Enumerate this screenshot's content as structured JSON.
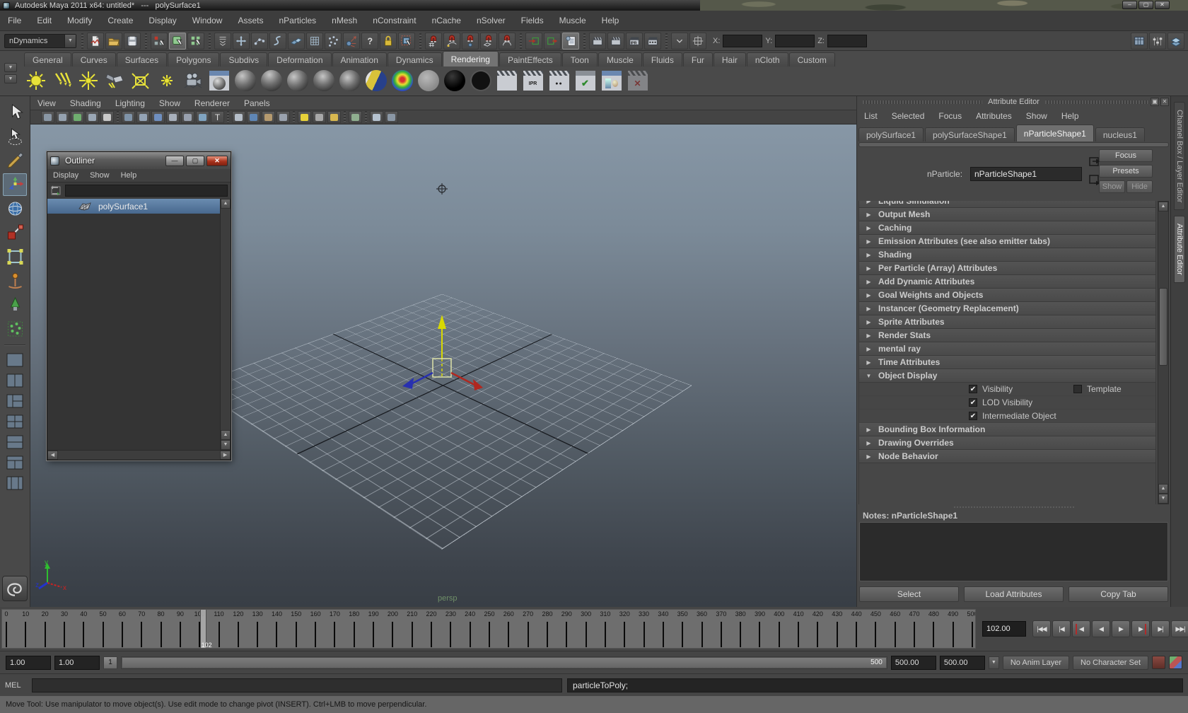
{
  "window": {
    "title": "Autodesk Maya 2011 x64: untitled*   ---   polySurface1",
    "controls": [
      {
        "name": "minimize-button",
        "glyph": "–"
      },
      {
        "name": "maximize-button",
        "glyph": "▢"
      },
      {
        "name": "close-button",
        "glyph": "✕"
      }
    ]
  },
  "menubar": {
    "items": [
      "File",
      "Edit",
      "Modify",
      "Create",
      "Display",
      "Window",
      "Assets",
      "nParticles",
      "nMesh",
      "nConstraint",
      "nCache",
      "nSolver",
      "Fields",
      "Muscle",
      "Help"
    ]
  },
  "statusline": {
    "menuset": "nDynamics",
    "coords": {
      "x_label": "X:",
      "y_label": "Y:",
      "z_label": "Z:",
      "x_value": "",
      "y_value": "",
      "z_value": ""
    },
    "icon_items": [
      {
        "sep": true
      },
      {
        "name": "new-scene-icon",
        "kind": "filenew"
      },
      {
        "name": "open-scene-icon",
        "kind": "fileopen"
      },
      {
        "name": "save-scene-icon",
        "kind": "filesave"
      },
      {
        "sep": true
      },
      {
        "name": "select-by-hierarchy-icon",
        "kind": "selhier"
      },
      {
        "name": "select-by-object-icon",
        "kind": "selobj",
        "active": true
      },
      {
        "name": "select-by-component-icon",
        "kind": "selcomp"
      },
      {
        "sep": true
      },
      {
        "name": "snap-toggle-chevron-icon",
        "kind": "chev"
      },
      {
        "name": "mask-handles-icon",
        "kind": "pluscross"
      },
      {
        "name": "mask-points-icon",
        "kind": "dotscurve"
      },
      {
        "name": "mask-curves-icon",
        "kind": "scurve"
      },
      {
        "name": "mask-surfaces-icon",
        "kind": "planes"
      },
      {
        "name": "mask-deformations-icon",
        "kind": "lattice"
      },
      {
        "name": "mask-dynamics-icon",
        "kind": "stardots"
      },
      {
        "name": "mask-rendering-icon",
        "kind": "emitter"
      },
      {
        "name": "mask-miscellaneous-icon",
        "kind": "question"
      },
      {
        "name": "lock-selection-icon",
        "kind": "lock"
      },
      {
        "name": "highlight-selection-icon",
        "kind": "dashedsel"
      },
      {
        "sep": true
      },
      {
        "name": "snap-to-grid-icon",
        "kind": "magnetgrid"
      },
      {
        "name": "snap-to-curve-icon",
        "kind": "magnetcurve"
      },
      {
        "name": "snap-to-point-icon",
        "kind": "magnetpoint"
      },
      {
        "name": "snap-to-plane-icon",
        "kind": "magnetplane"
      },
      {
        "name": "snap-to-viewplane-icon",
        "kind": "magnetarc"
      },
      {
        "sep": true
      },
      {
        "name": "input-connections-icon",
        "kind": "inputconn"
      },
      {
        "name": "output-connections-icon",
        "kind": "outputconn"
      },
      {
        "name": "construction-history-icon",
        "kind": "history",
        "active": true
      },
      {
        "sep": true
      },
      {
        "name": "open-render-view-icon",
        "kind": "clapper"
      },
      {
        "name": "render-current-frame-icon",
        "kind": "clapper"
      },
      {
        "name": "ipr-render-icon",
        "kind": "clapperipr"
      },
      {
        "name": "render-settings-icon",
        "kind": "clapperdots"
      },
      {
        "sep": true
      },
      {
        "name": "quick-select-chevron-icon",
        "kind": "chevdown"
      },
      {
        "name": "pivot-box-icon",
        "kind": "pivotbox"
      }
    ],
    "right_icons": [
      {
        "name": "channel-box-toggle-icon",
        "kind": "tablegrid"
      },
      {
        "name": "tool-settings-toggle-icon",
        "kind": "sliders"
      },
      {
        "name": "attribute-editor-toggle-icon",
        "kind": "layers"
      }
    ]
  },
  "shelf": {
    "active_tab": "Rendering",
    "tabs": [
      "General",
      "Curves",
      "Surfaces",
      "Polygons",
      "Subdivs",
      "Deformation",
      "Animation",
      "Dynamics",
      "Rendering",
      "PaintEffects",
      "Toon",
      "Muscle",
      "Fluids",
      "Fur",
      "Hair",
      "nCloth",
      "Custom"
    ],
    "icons": [
      {
        "name": "ambient-light-shelf-icon",
        "kind": "sun"
      },
      {
        "name": "directional-light-shelf-icon",
        "kind": "rays"
      },
      {
        "name": "point-light-shelf-icon",
        "kind": "star"
      },
      {
        "name": "spot-light-shelf-icon",
        "kind": "flash"
      },
      {
        "name": "area-light-shelf-icon",
        "kind": "area"
      },
      {
        "name": "volume-light-shelf-icon",
        "kind": "burst"
      },
      {
        "name": "camera-shelf-icon",
        "kind": "camera"
      },
      {
        "name": "shading-swatch-shelf-icon",
        "kind": "swatchwin"
      },
      {
        "name": "anisotropic-material-shelf-icon",
        "kind": "sphere1"
      },
      {
        "name": "blinn-material-shelf-icon",
        "kind": "sphere2"
      },
      {
        "name": "lambert-material-shelf-icon",
        "kind": "sphere3"
      },
      {
        "name": "phong-material-shelf-icon",
        "kind": "sphere4"
      },
      {
        "name": "phonge-material-shelf-icon",
        "kind": "sphere5"
      },
      {
        "name": "layered-shader-shelf-icon",
        "kind": "duo"
      },
      {
        "name": "ramp-shader-shelf-icon",
        "kind": "rainbow"
      },
      {
        "name": "shading-map-shelf-icon",
        "kind": "flat"
      },
      {
        "name": "surface-shader-shelf-icon",
        "kind": "black"
      },
      {
        "name": "use-background-shelf-icon",
        "kind": "ring"
      },
      {
        "name": "render-frame-shelf-icon",
        "kind": "clapwin"
      },
      {
        "name": "ipr-render-shelf-icon",
        "kind": "clapipr"
      },
      {
        "name": "render-settings-shelf-icon",
        "kind": "clapdots"
      },
      {
        "name": "batch-render-shelf-icon",
        "kind": "wincheck"
      },
      {
        "name": "hypershade-shelf-icon",
        "kind": "wintubes"
      },
      {
        "name": "cancel-render-shelf-icon",
        "kind": "windim"
      }
    ]
  },
  "panel": {
    "menus": [
      "View",
      "Shading",
      "Lighting",
      "Show",
      "Renderer",
      "Panels"
    ],
    "camera_label": "persp",
    "iconbar": [
      "cam",
      "camkey",
      "green",
      "cube",
      "axis",
      "sep",
      "iso",
      "grid",
      "sphere",
      "circle",
      "x",
      "img",
      "textT",
      "sep",
      "wirecube",
      "bluecube",
      "texcube",
      "film",
      "sep",
      "bulbY",
      "bulbG",
      "bulbA",
      "sep",
      "selbox",
      "sep",
      "cubeplus",
      "panes"
    ]
  },
  "toolbox": {
    "tools": [
      {
        "name": "select-tool",
        "kind": "arrow"
      },
      {
        "name": "lasso-tool",
        "kind": "lasso"
      },
      {
        "name": "paint-select-tool",
        "kind": "brush"
      },
      {
        "name": "move-tool",
        "kind": "move",
        "active": true
      },
      {
        "name": "rotate-tool",
        "kind": "rotate"
      },
      {
        "name": "scale-tool",
        "kind": "scale"
      },
      {
        "name": "universal-manipulator-tool",
        "kind": "universal"
      },
      {
        "name": "soft-modification-tool",
        "kind": "softmod"
      },
      {
        "name": "show-manipulator-tool",
        "kind": "showmanip"
      },
      {
        "name": "last-tool-nparticle",
        "kind": "particles"
      }
    ],
    "layouts": [
      {
        "name": "single-pane-layout",
        "kind": "l1"
      },
      {
        "name": "two-pane-layout",
        "kind": "l2"
      },
      {
        "name": "outliner-persp-layout",
        "kind": "l3"
      },
      {
        "name": "four-pane-layout",
        "kind": "l4"
      },
      {
        "name": "persp-graph-layout",
        "kind": "l5"
      },
      {
        "name": "hypershade-persp-layout",
        "kind": "l6"
      },
      {
        "name": "paint-effects-layout",
        "kind": "l7"
      }
    ]
  },
  "outliner": {
    "title": "Outliner",
    "menus": [
      "Display",
      "Show",
      "Help"
    ],
    "search_value": "",
    "items": [
      {
        "label": "polySurface1",
        "selected": true
      }
    ]
  },
  "attribute_editor": {
    "title": "Attribute Editor",
    "menus": [
      "List",
      "Selected",
      "Focus",
      "Attributes",
      "Show",
      "Help"
    ],
    "tabs": [
      "polySurface1",
      "polySurfaceShape1",
      "nParticleShape1",
      "nucleus1"
    ],
    "active_tab": "nParticleShape1",
    "name_row": {
      "label": "nParticle:",
      "value": "nParticleShape1"
    },
    "focus_btn": "Focus",
    "presets_btn": "Presets",
    "show_btn": "Show",
    "hide_btn": "Hide",
    "sections": [
      {
        "label": "Liquid Simulation"
      },
      {
        "label": "Output Mesh"
      },
      {
        "label": "Caching"
      },
      {
        "label": "Emission Attributes (see also emitter tabs)"
      },
      {
        "label": "Shading"
      },
      {
        "label": "Per Particle (Array) Attributes"
      },
      {
        "label": "Add Dynamic Attributes"
      },
      {
        "label": "Goal Weights and Objects"
      },
      {
        "label": "Instancer (Geometry Replacement)"
      },
      {
        "label": "Sprite Attributes"
      },
      {
        "label": "Render Stats"
      },
      {
        "label": "mental ray"
      },
      {
        "label": "Time Attributes"
      },
      {
        "label": "Object Display",
        "expanded": true,
        "children": [
          {
            "checkboxes": [
              {
                "label": "Visibility",
                "checked": true
              },
              {
                "label": "Template",
                "checked": false
              }
            ]
          },
          {
            "checkboxes": [
              {
                "label": "LOD Visibility",
                "checked": true
              }
            ]
          },
          {
            "checkboxes": [
              {
                "label": "Intermediate Object",
                "checked": true
              }
            ]
          }
        ]
      },
      {
        "label": "Bounding Box Information"
      },
      {
        "label": "Drawing Overrides"
      },
      {
        "label": "Node Behavior"
      }
    ],
    "notes_label": "Notes: nParticleShape1",
    "notes_value": "",
    "bottom_buttons": [
      "Select",
      "Load Attributes",
      "Copy Tab"
    ],
    "side_tabs": [
      {
        "label": "Channel Box / Layer Editor",
        "active": false
      },
      {
        "label": "Attribute Editor",
        "active": true
      }
    ]
  },
  "time_slider": {
    "start": 0,
    "end": 500,
    "label_step": 10,
    "current_frame": 102,
    "current_frame_label": "102",
    "current_time_value": "102.00",
    "playback": [
      {
        "name": "go-to-start-button",
        "glyph": "|◀◀"
      },
      {
        "name": "step-back-frame-button",
        "glyph": "|◀"
      },
      {
        "name": "step-back-key-button",
        "glyph": "◀",
        "red": "left"
      },
      {
        "name": "play-backwards-button",
        "glyph": "◀"
      },
      {
        "name": "play-forwards-button",
        "glyph": "▶"
      },
      {
        "name": "step-forward-key-button",
        "glyph": "▶",
        "red": "right"
      },
      {
        "name": "step-forward-frame-button",
        "glyph": "▶|"
      },
      {
        "name": "go-to-end-button",
        "glyph": "▶▶|"
      }
    ]
  },
  "range_slider": {
    "animation_start": "1.00",
    "playback_start": "1.00",
    "handle_start": "1",
    "handle_end": "500",
    "playback_end": "500.00",
    "animation_end": "500.00",
    "anim_layer": "No Anim Layer",
    "character_set": "No Character Set"
  },
  "command_line": {
    "label": "MEL",
    "input_value": "",
    "output_value": "particleToPoly;"
  },
  "help_line": {
    "text": "Move Tool: Use manipulator to move object(s). Use edit mode to change pivot (INSERT).  Ctrl+LMB to move perpendicular."
  },
  "viewport_axis": {
    "x": "x",
    "y": "y",
    "z": "z"
  }
}
